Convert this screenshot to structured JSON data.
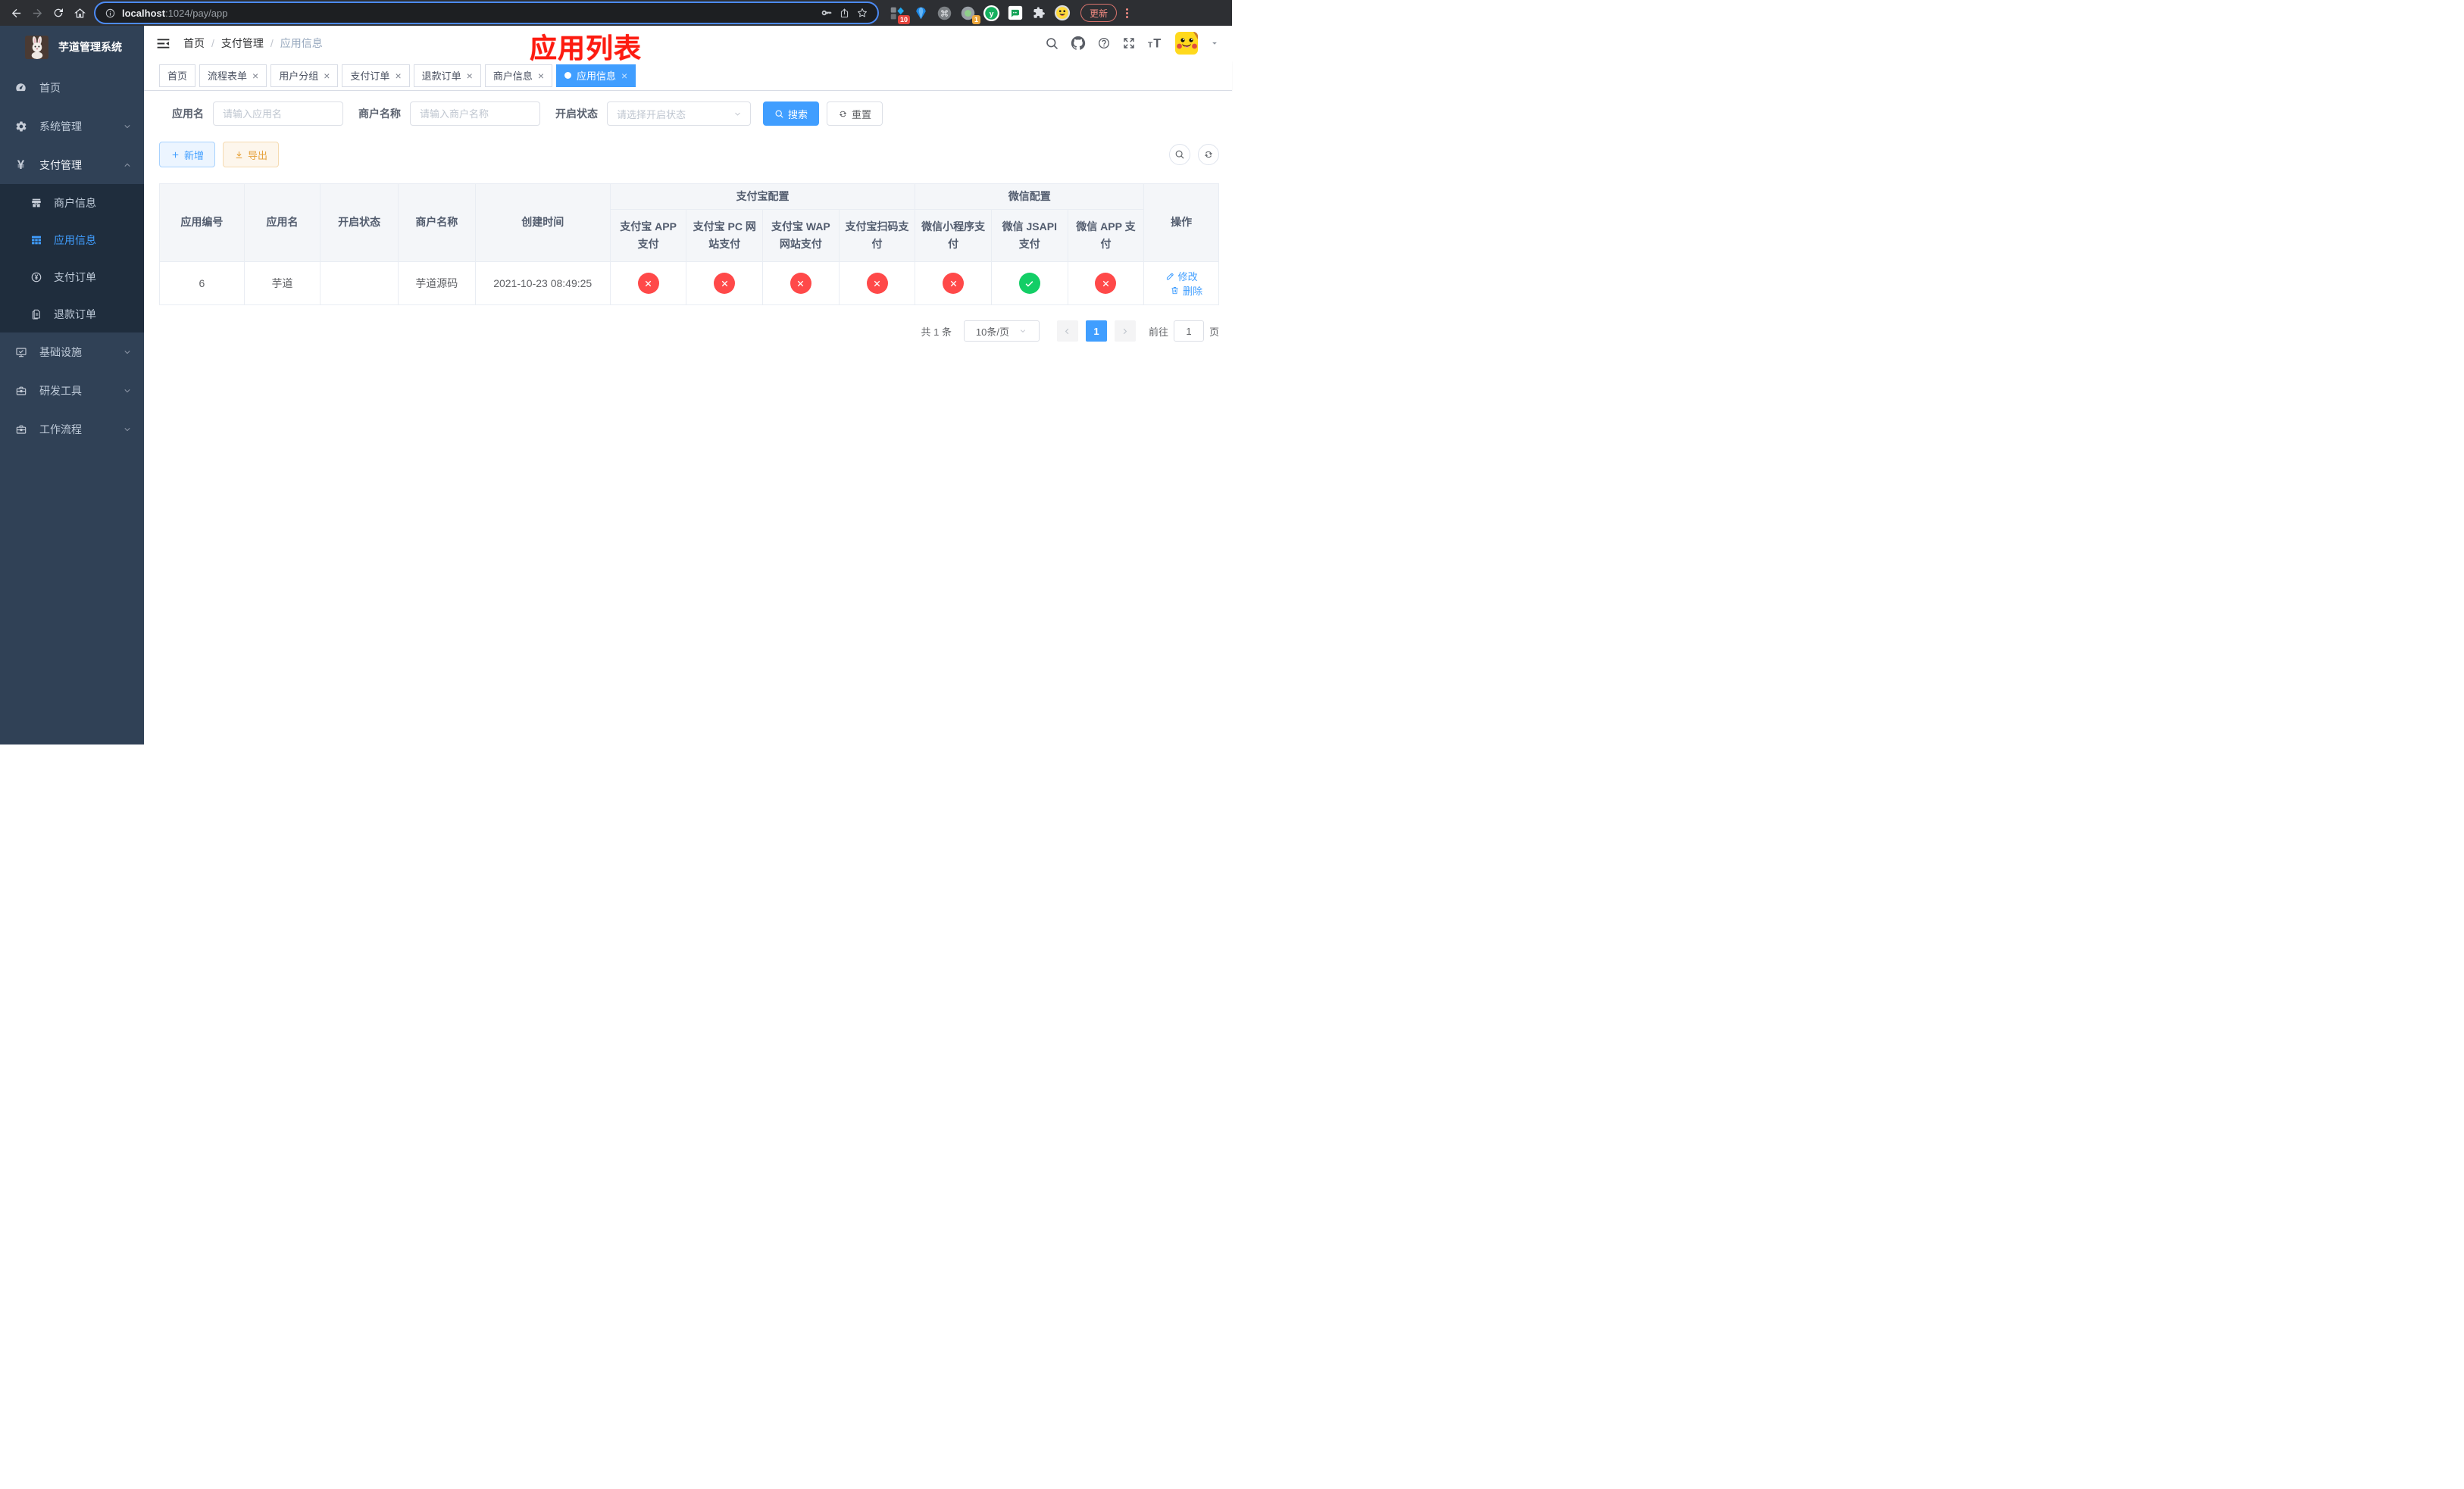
{
  "colors": {
    "accent": "#409eff",
    "success": "#13ce66",
    "danger": "#ff4949",
    "warning": "#e6a23c",
    "sidebar_bg": "#304156",
    "submenu_bg": "#1f2d3d",
    "annotation_red": "#fd1b10"
  },
  "browser": {
    "url_host": "localhost",
    "url_path": ":1024/pay/app",
    "update_label": "更新",
    "extension_badges": {
      "blocks": "10",
      "recorder": "1"
    }
  },
  "sidebar": {
    "title": "芋道管理系统",
    "items": [
      {
        "label": "首页"
      },
      {
        "label": "系统管理"
      },
      {
        "label": "支付管理"
      },
      {
        "label": "商户信息"
      },
      {
        "label": "应用信息"
      },
      {
        "label": "支付订单"
      },
      {
        "label": "退款订单"
      },
      {
        "label": "基础设施"
      },
      {
        "label": "研发工具"
      },
      {
        "label": "工作流程"
      }
    ]
  },
  "navbar": {
    "breadcrumb": [
      {
        "label": "首页"
      },
      {
        "label": "支付管理"
      },
      {
        "label": "应用信息"
      }
    ],
    "annotation": "应用列表"
  },
  "tabbar": {
    "tabs": [
      {
        "label": "首页",
        "closable": false,
        "active": false
      },
      {
        "label": "流程表单",
        "closable": true,
        "active": false
      },
      {
        "label": "用户分组",
        "closable": true,
        "active": false
      },
      {
        "label": "支付订单",
        "closable": true,
        "active": false
      },
      {
        "label": "退款订单",
        "closable": true,
        "active": false
      },
      {
        "label": "商户信息",
        "closable": true,
        "active": false
      },
      {
        "label": "应用信息",
        "closable": true,
        "active": true
      }
    ]
  },
  "filters": {
    "app_name": {
      "label": "应用名",
      "placeholder": "请输入应用名",
      "value": ""
    },
    "merchant_name": {
      "label": "商户名称",
      "placeholder": "请输入商户名称",
      "value": ""
    },
    "status": {
      "label": "开启状态",
      "placeholder": "请选择开启状态",
      "value": ""
    },
    "search_label": "搜索",
    "reset_label": "重置"
  },
  "toolbar": {
    "add_label": "新增",
    "export_label": "导出"
  },
  "table": {
    "headers": {
      "app_id": "应用编号",
      "app_name": "应用名",
      "status": "开启状态",
      "merchant": "商户名称",
      "created": "创建时间",
      "alipay_group": "支付宝配置",
      "wechat_group": "微信配置",
      "channels": [
        "支付宝 APP 支付",
        "支付宝 PC 网站支付",
        "支付宝 WAP 网站支付",
        "支付宝扫码支付",
        "微信小程序支付",
        "微信 JSAPI 支付",
        "微信 APP 支付"
      ],
      "actions": "操作"
    },
    "rows": [
      {
        "app_id": "6",
        "app_name": "芋道",
        "enabled": true,
        "merchant": "芋道源码",
        "created": "2021-10-23 08:49:25",
        "channel_enabled": [
          false,
          false,
          false,
          false,
          false,
          true,
          false
        ],
        "edit_label": "修改",
        "delete_label": "删除"
      }
    ]
  },
  "pagination": {
    "total": "共 1 条",
    "page_size": "10条/页",
    "current_page": "1",
    "goto_label": "前往",
    "goto_value": "1",
    "page_unit": "页"
  }
}
